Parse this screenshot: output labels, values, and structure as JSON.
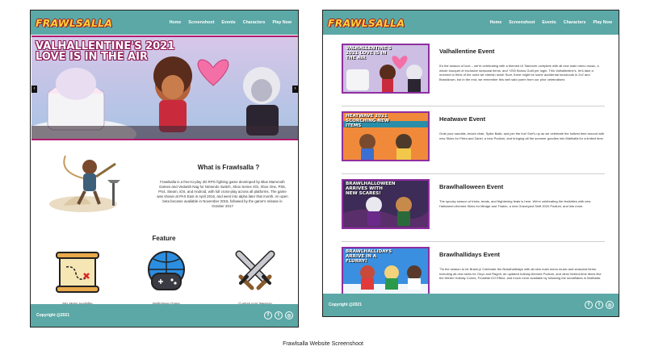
{
  "brand": {
    "logo": "FRAWLSALLA",
    "accent": "#5ba8a6",
    "logo_color": "#ffd23a"
  },
  "nav": [
    "Home",
    "Screenshoot",
    "Events",
    "Characters",
    "Play Now"
  ],
  "home": {
    "hero_title_line1": "VALHALLENTINE'S 2021",
    "hero_title_line2": "LOVE IS IN THE AIR",
    "about_title": "What is Frawlsalla ?",
    "about_text": "Frawlsalla is a free-to-play 2D RPG fighting game developed by Blue Mammoth Games and Vedanth Nag for Nintendo Switch, Xbox Series X/S, Xbox One, PS5, PS4, Steam, iOS, and Android, with full cross-play across all platforms. The game was shown at PAX East in April 2016, and went into alpha later that month. An open beta became available in November 2015, followed by the game's release in October 2017",
    "feature_title": "Feature",
    "features": [
      {
        "label": "50+ Maps Available",
        "icon": "treasure-map-icon"
      },
      {
        "label": "Multiplayer Game",
        "icon": "globe-gamepad-icon"
      },
      {
        "label": "Custom your Weapon",
        "icon": "crossed-swords-icon"
      }
    ]
  },
  "events": [
    {
      "title": "Valhallentine Event",
      "thumb_caption": "VALHALLENTINE'S 2021 LOVE IS IN THE AIR",
      "text": "It's the season of love – we're celebrating with a themed UI Takeover complete with all new main menu music, a whole bouquet of exclusive seasonal items, and +250 Bonus Gold per login. This Valhallentine's, let's take a moment to think of the ones we cherish most! Sure, there might be some accidental knockouts in 2v2 and Brawldown, but in the end, we remember this well said poem from our prior celebrations"
    },
    {
      "title": "Heatwave Event",
      "thumb_caption": "HEATWAVE 2021 SCORCHING NEW ITEMS",
      "text": "Grab your sandals, beach chair, Spike Balls, and join the fun! Surf's up as we celebrate the hottest time around with new Skins for Petra and Zariel, a new Podium, and bringing all the summer goodies into Mallhalla for a limited time."
    },
    {
      "title": "Brawlhalloween Event",
      "thumb_caption": "BRAWLHALLOWEEN ARRIVES WITH NEW SCARES!",
      "text": "The spooky season of tricks, treats, and frightening feats is here. We're celebrating the festivities with new Halloween-themed Skins for Mirage and Thatch, a new Graveyard Shift 2020 Podium, and lots more."
    },
    {
      "title": "Brawlhallidays Event",
      "thumb_caption": "BRAWLHALLIDAYS ARRIVE IN A FLURRY!",
      "text": "'Tis the season to be Brawl-y! Celebrate the Brawlhallidays with all-new main menu music and seasonal items. Including all-new skins for Onyx and Ragnir, an updated holiday-themed Podium, and other limited-time items like the Winter Holiday Colors, Frostbite KO Effect, and much more available by following the snowflakes in Mallhalla."
    }
  ],
  "footer": {
    "copyright": "Copyright @2021",
    "socials": [
      "facebook-icon",
      "twitter-icon",
      "instagram-icon"
    ]
  },
  "caption": "Frawlsalla Website Screenshoot"
}
